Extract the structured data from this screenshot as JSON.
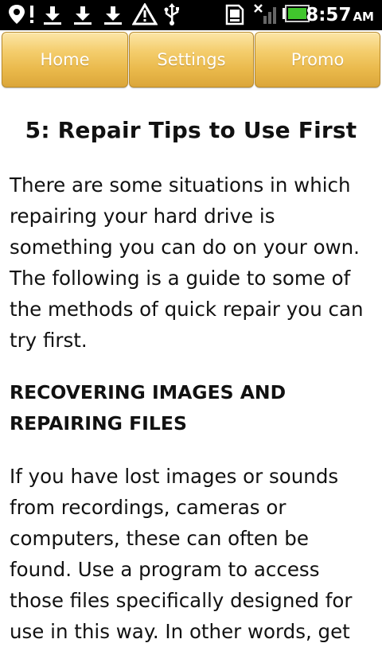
{
  "status_bar": {
    "time": "8:57",
    "ampm": "AM",
    "icons": [
      "location-pin-icon",
      "download-icon",
      "download-icon",
      "download-icon",
      "warning-icon",
      "usb-icon",
      "sd-card-icon",
      "no-signal-icon",
      "battery-icon"
    ]
  },
  "nav": {
    "tabs": [
      {
        "label": "Home"
      },
      {
        "label": "Settings"
      },
      {
        "label": "Promo"
      }
    ]
  },
  "article": {
    "title": "5: Repair Tips to Use First",
    "intro_lines": [
      "There are some situations in which",
      "repairing your hard drive is",
      "something you can do on your own.",
      "The following is a guide to some of",
      "the methods of quick repair you can",
      "try first."
    ],
    "section_heading_lines": [
      "RECOVERING IMAGES AND",
      "REPAIRING FILES"
    ],
    "section_lines": [
      "If you have lost images or sounds",
      "from recordings, cameras or",
      "computers, these can often be",
      "found. Use a program to access",
      "those files specifically designed for",
      "use in this way. In other words, get"
    ]
  }
}
